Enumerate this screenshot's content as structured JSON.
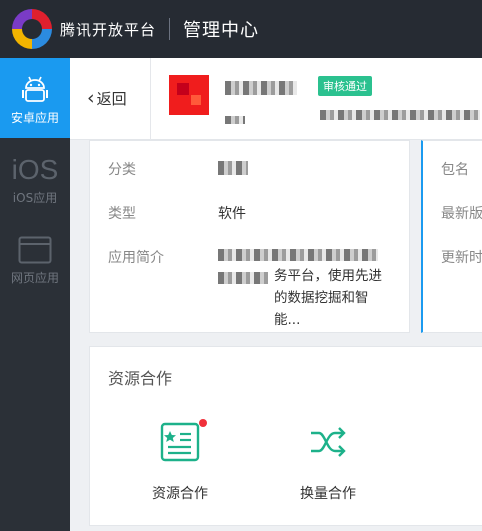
{
  "topbar": {
    "brand": "腾讯开放平台",
    "section": "管理中心"
  },
  "sidebar": {
    "items": [
      {
        "label": "安卓应用",
        "icon": "android-icon",
        "active": true
      },
      {
        "label": "iOS应用",
        "icon_text": "iOS",
        "icon": "ios-icon",
        "active": false
      },
      {
        "label": "网页应用",
        "icon": "browser-window-icon",
        "active": false
      }
    ]
  },
  "header": {
    "back_label": "返回",
    "review_badge": "审核通过"
  },
  "info": {
    "category_label": "分类",
    "type_label": "类型",
    "type_value": "软件",
    "desc_label": "应用简介",
    "desc_visible": "务平台，使用先进的数据挖掘和智能...",
    "right_labels": [
      "包名",
      "最新版",
      "更新时"
    ]
  },
  "coop": {
    "title": "资源合作",
    "items": [
      {
        "label": "资源合作",
        "icon": "resource-doc-icon",
        "has_dot": true
      },
      {
        "label": "换量合作",
        "icon": "shuffle-icon",
        "has_dot": false
      }
    ]
  },
  "colors": {
    "accent": "#1a9af0",
    "badge": "#2bc18f",
    "icon_green": "#1db18a",
    "dot": "#f0303a"
  }
}
